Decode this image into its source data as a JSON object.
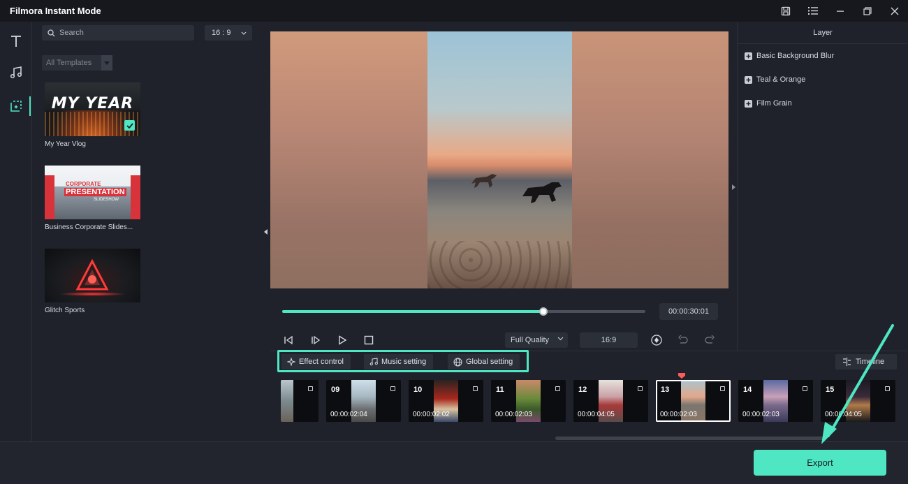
{
  "app": {
    "title": "Filmora Instant Mode"
  },
  "templates": {
    "search_placeholder": "Search",
    "ratio": "16 : 9",
    "filter": "All Templates",
    "items": [
      {
        "label": "My Year Vlog",
        "thumb_text": "MY YEAR",
        "selected": true
      },
      {
        "label": "Business Corporate Slides...",
        "thumb_text_1": "CORPORATE",
        "thumb_text_2": "PRESENTATION",
        "thumb_text_3": "SLIDESHOW"
      },
      {
        "label": "Glitch Sports"
      }
    ]
  },
  "player": {
    "timecode": "00:00:30:01",
    "progress": 0.72,
    "quality": "Full Quality",
    "ratio": "16:9"
  },
  "layer": {
    "title": "Layer",
    "items": [
      "Basic Background Blur",
      "Teal & Orange",
      "Film Grain"
    ]
  },
  "tabs": {
    "effect": "Effect control",
    "music": "Music setting",
    "global": "Global setting",
    "timeline": "Timeline"
  },
  "clips": [
    {
      "num": "",
      "dur": ""
    },
    {
      "num": "09",
      "dur": "00:00:02:04"
    },
    {
      "num": "10",
      "dur": "00:00:02:02"
    },
    {
      "num": "11",
      "dur": "00:00:02:03"
    },
    {
      "num": "12",
      "dur": "00:00:04:05"
    },
    {
      "num": "13",
      "dur": "00:00:02:03",
      "selected": true
    },
    {
      "num": "14",
      "dur": "00:00:02:03"
    },
    {
      "num": "15",
      "dur": "00:00:04:05"
    }
  ],
  "footer": {
    "export_label": "Export"
  },
  "colors": {
    "accent": "#4ee6c3",
    "bg": "#1f222a"
  }
}
